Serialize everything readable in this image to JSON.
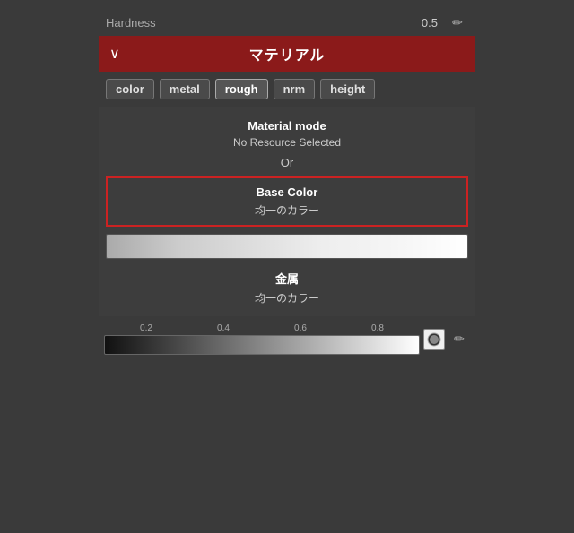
{
  "hardness": {
    "label": "Hardness",
    "value": "0.5"
  },
  "materialHeader": {
    "chevron": "∨",
    "title": "マテリアル"
  },
  "tabs": [
    {
      "id": "color",
      "label": "color",
      "active": false
    },
    {
      "id": "metal",
      "label": "metal",
      "active": false
    },
    {
      "id": "rough",
      "label": "rough",
      "active": true
    },
    {
      "id": "nrm",
      "label": "nrm",
      "active": false
    },
    {
      "id": "height",
      "label": "height",
      "active": false
    }
  ],
  "materialMode": {
    "label": "Material mode",
    "value": "No Resource Selected"
  },
  "orDivider": "Or",
  "baseColor": {
    "label": "Base Color",
    "value": "均一のカラー"
  },
  "metalSection": {
    "label": "金属",
    "value": "均一のカラー"
  },
  "sliderTicks": [
    "0.2",
    "0.4",
    "0.6",
    "0.8"
  ],
  "icons": {
    "pencil": "✏",
    "circle": "●"
  }
}
